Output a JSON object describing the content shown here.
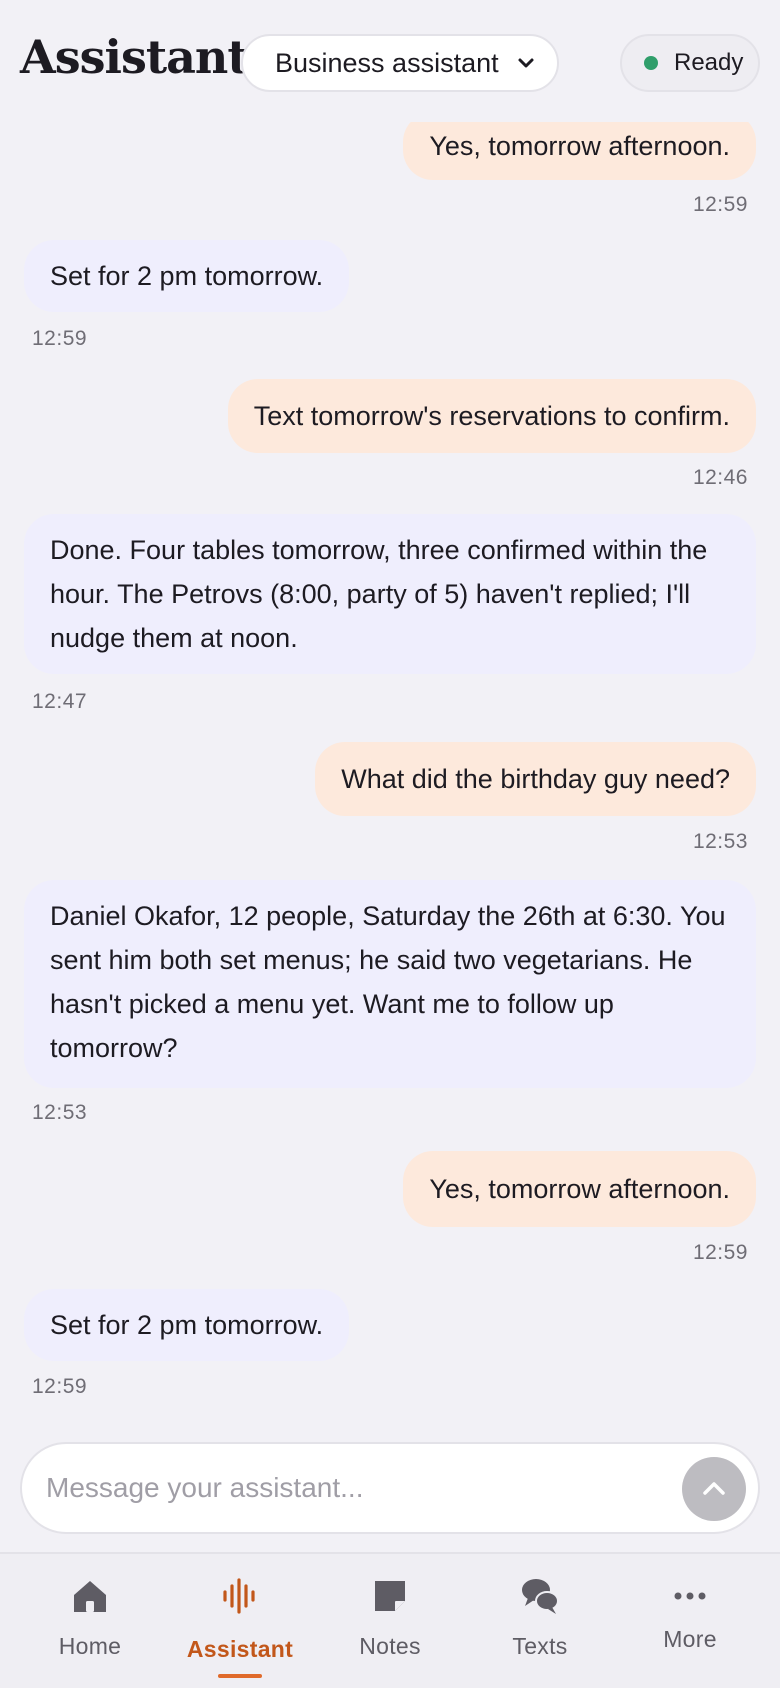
{
  "header": {
    "title": "Assistant",
    "mode_selected": "Business assistant",
    "status_label": "Ready",
    "status_color": "#2f9e6b"
  },
  "conversation": {
    "messages": [
      {
        "role": "user",
        "text": "Yes, tomorrow afternoon.",
        "time": "12:59"
      },
      {
        "role": "assistant",
        "text": "Set for 2 pm tomorrow.",
        "time": "12:59"
      },
      {
        "role": "user",
        "text": "Text tomorrow's reservations to confirm.",
        "time": "12:46"
      },
      {
        "role": "assistant",
        "text": "Done. Four tables tomorrow, three confirmed within the hour. The Petrovs (8:00, party of 5) haven't replied; I'll nudge them at noon.",
        "time": "12:47"
      },
      {
        "role": "user",
        "text": "What did the birthday guy need?",
        "time": "12:53"
      },
      {
        "role": "assistant",
        "text": "Daniel Okafor, 12 people, Saturday the 26th at 6:30. You sent him both set menus; he said two vegetarians. He hasn't picked a menu yet. Want me to follow up tomorrow?",
        "time": "12:53"
      },
      {
        "role": "user",
        "text": "Yes, tomorrow afternoon.",
        "time": "12:59"
      },
      {
        "role": "assistant",
        "text": "Set for 2 pm tomorrow.",
        "time": "12:59"
      }
    ]
  },
  "composer": {
    "placeholder": "Message your assistant...",
    "send_icon": "chevron-up-icon"
  },
  "nav": {
    "items": [
      {
        "label": "Home",
        "icon": "home-icon",
        "active": false
      },
      {
        "label": "Assistant",
        "icon": "waveform-icon",
        "active": true
      },
      {
        "label": "Notes",
        "icon": "note-icon",
        "active": false
      },
      {
        "label": "Texts",
        "icon": "chat-bubbles-icon",
        "active": false
      },
      {
        "label": "More",
        "icon": "more-dots-icon",
        "active": false
      }
    ],
    "active_color": "#c2571a"
  },
  "colors": {
    "user_bubble": "#fde9dc",
    "assistant_bubble": "#efeefd",
    "background": "#f2f1f6"
  }
}
